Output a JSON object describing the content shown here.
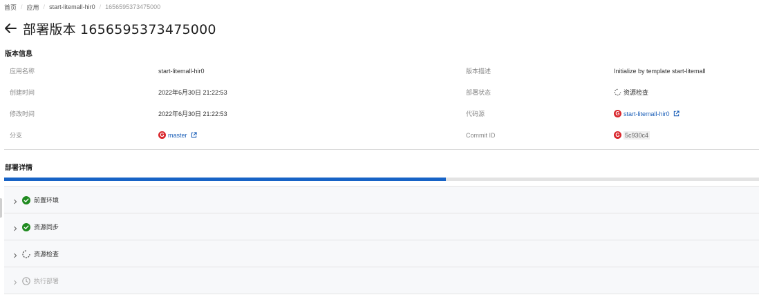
{
  "breadcrumb": [
    {
      "label": "首页"
    },
    {
      "label": "应用"
    },
    {
      "label": "start-litemall-hir0"
    },
    {
      "label": "1656595373475000"
    }
  ],
  "header": {
    "title": "部署版本 1656595373475000"
  },
  "version_info": {
    "section_title": "版本信息",
    "rows": [
      {
        "left_label": "应用名称",
        "left_value": "start-litemall-hir0",
        "right_label": "版本描述",
        "right_value": "Initialize by template start-litemall"
      },
      {
        "left_label": "创建时间",
        "left_value": "2022年6月30日 21:22:53",
        "right_label": "部署状态",
        "right_value": "资源检查"
      },
      {
        "left_label": "修改时间",
        "left_value": "2022年6月30日 21:22:53",
        "right_label": "代码源",
        "right_value": "start-litemall-hir0"
      },
      {
        "left_label": "分支",
        "left_value": "master",
        "right_label": "Commit ID",
        "right_value": "5c930c4"
      }
    ]
  },
  "deploy_details": {
    "section_title": "部署详情",
    "progress_fraction": 0.585,
    "progress_color": "#1763c6",
    "steps": [
      {
        "label": "前置环境",
        "status": "success",
        "icon": "check-circle-icon"
      },
      {
        "label": "资源同步",
        "status": "success",
        "icon": "check-circle-icon"
      },
      {
        "label": "资源检查",
        "status": "running",
        "icon": "spinner-icon"
      },
      {
        "label": "执行部署",
        "status": "pending",
        "icon": "clock-icon"
      }
    ]
  },
  "colors": {
    "success": "#1f8a1f",
    "link": "#1b5fb8",
    "git": "#d9262c"
  }
}
